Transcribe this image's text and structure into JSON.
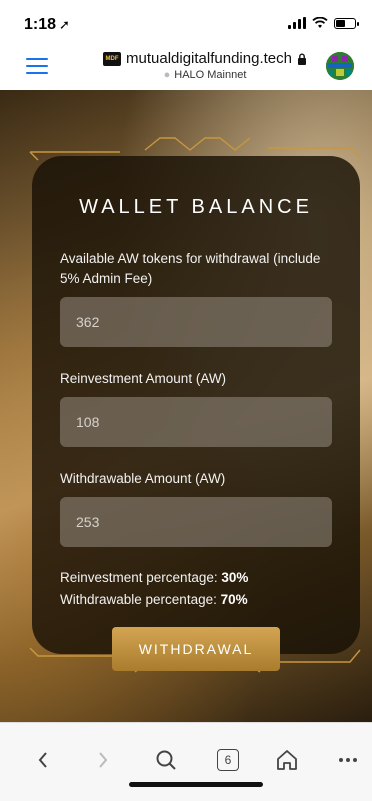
{
  "status_bar": {
    "time": "1:18"
  },
  "browser": {
    "domain": "mutualdigitalfunding.tech",
    "network": "HALO Mainnet",
    "logo_text": "MDF"
  },
  "wallet": {
    "title": "WALLET BALANCE",
    "available_label": "Available AW tokens for withdrawal (include 5% Admin Fee)",
    "available_value": "362",
    "reinvest_label": "Reinvestment Amount (AW)",
    "reinvest_value": "108",
    "withdrawable_label": "Withdrawable Amount (AW)",
    "withdrawable_value": "253",
    "reinvest_pct_label": "Reinvestment percentage:",
    "reinvest_pct_value": "30%",
    "withdraw_pct_label": "Withdrawable percentage:",
    "withdraw_pct_value": "70%",
    "button_label": "WITHDRAWAL"
  },
  "toolbar": {
    "tabs_count": "6"
  },
  "icons": {
    "location": "location-arrow-icon",
    "signal": "cellular-signal-icon",
    "wifi": "wifi-icon",
    "battery": "battery-icon",
    "menu": "hamburger-menu-icon",
    "lock": "lock-icon",
    "back": "chevron-left-icon",
    "forward": "chevron-right-icon",
    "search": "search-icon",
    "home": "home-icon",
    "more": "more-icon"
  },
  "colors": {
    "accent": "#1a73e8",
    "gold": "#c8973f"
  }
}
